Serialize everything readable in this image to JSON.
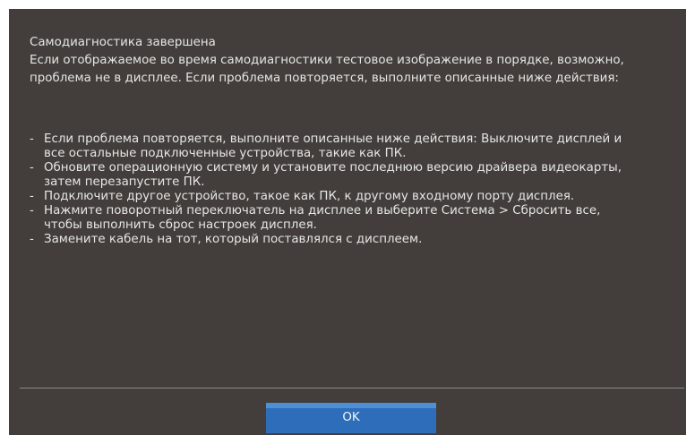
{
  "dialog": {
    "heading": "Самодиагностика завершена",
    "intro_lines": [
      "Если отображаемое во время самодиагностики тестовое изображение в порядке, возможно,",
      "проблема не в дисплее.  Если проблема повторяется, выполните описанные ниже действия:"
    ],
    "bullet": "-",
    "steps": [
      {
        "lines": [
          "Если проблема повторяется, выполните описанные ниже действия:  Выключите дисплей и",
          "все остальные подключенные устройства, такие как ПК."
        ]
      },
      {
        "lines": [
          "Обновите операционную систему и установите последнюю версию драйвера видеокарты,",
          "затем перезапустите ПК."
        ]
      },
      {
        "lines": [
          "Подключите другое устройство, такое как ПК, к другому входному порту дисплея."
        ]
      },
      {
        "lines": [
          "Нажмите поворотный переключатель на дисплее и выберите Система > Сбросить все,",
          "чтобы выполнить сброс настроек дисплея."
        ]
      },
      {
        "lines": [
          "Замените кабель на тот, который поставлялся с дисплеем."
        ]
      }
    ],
    "ok_label": "OK"
  },
  "colors": {
    "dialog_background": "#433e3b",
    "text": "#e6e6e6",
    "button_top_stripe": "#4f8fd4",
    "button_background": "#2e6dba",
    "divider": "#8a8784"
  }
}
